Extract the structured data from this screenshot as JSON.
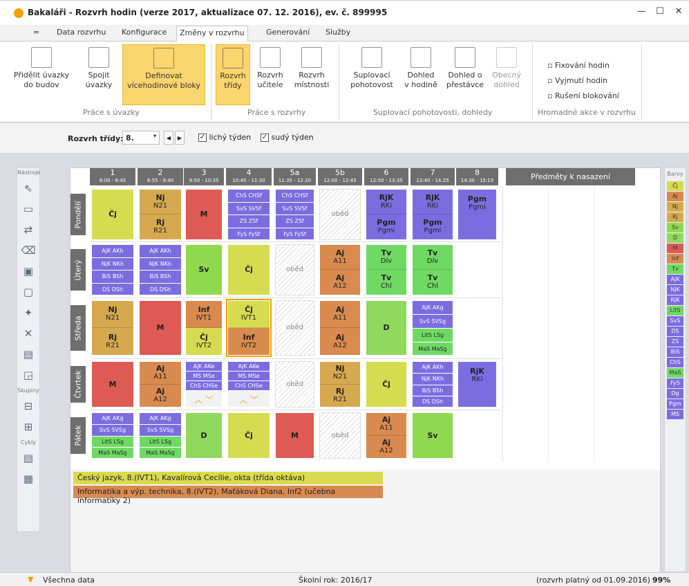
{
  "window": {
    "title": "Bakaláři - Rozvrh hodin (verze 2017, aktualizace 07. 12. 2016), ev. č. 899995",
    "minimize": "—",
    "maximize": "☐",
    "close": "✕"
  },
  "menu": {
    "tabs": [
      "=",
      "Data rozvrhu",
      "Konfigurace",
      "Změny v rozvrhu",
      "Generování",
      "Služby"
    ]
  },
  "ribbon": {
    "buttons": [
      {
        "l1": "Přidělit úvazky",
        "l2": "do budov"
      },
      {
        "l1": "Spojit",
        "l2": "úvazky"
      },
      {
        "l1": "Definovat",
        "l2": "vícehodinové bloky"
      },
      {
        "l1": "Rozvrh",
        "l2": "třídy"
      },
      {
        "l1": "Rozvrh",
        "l2": "učitele"
      },
      {
        "l1": "Rozvrh",
        "l2": "místnosti"
      },
      {
        "l1": "Suplovací",
        "l2": "pohotovost"
      },
      {
        "l1": "Dohled",
        "l2": "v hodině"
      },
      {
        "l1": "Dohled o",
        "l2": "přestávce"
      },
      {
        "l1": "Obecný",
        "l2": "dohled"
      }
    ],
    "small": [
      "Fixování hodin",
      "Vyjmutí hodin",
      "Rušení blokování"
    ],
    "groups": [
      "Práce s úvazky",
      "Práce s rozvrhy",
      "Suplovací pohotovosti, dohledy",
      "Hromadné akce v rozvrhu"
    ]
  },
  "filter": {
    "label": "Rozvrh třídy:",
    "value": "8.",
    "odd": "lichý týden",
    "even": "sudý týden",
    "check": "✓"
  },
  "leftbar": {
    "h1": "Nástroje",
    "h2": "Skupiny",
    "h3": "Cykly"
  },
  "header": {
    "periods": [
      {
        "n": "1",
        "t": "8:00 - 8:45"
      },
      {
        "n": "2",
        "t": "8:55 - 9:40"
      },
      {
        "n": "3",
        "t": "9:50 - 10:35"
      },
      {
        "n": "4",
        "t": "10:45 - 11:30"
      },
      {
        "n": "5a",
        "t": "11:35 - 12:20"
      },
      {
        "n": "5b",
        "t": "12:00 - 12:45"
      },
      {
        "n": "6",
        "t": "12:50 - 13:35"
      },
      {
        "n": "7",
        "t": "13:40 - 14:25"
      },
      {
        "n": "8",
        "t": "14:30 - 15:15"
      }
    ],
    "subjects_panel": "Předměty k nasazení"
  },
  "days": [
    "Pondělí",
    "Úterý",
    "Středa",
    "Čtvrtek",
    "Pátek"
  ],
  "obed": "oběd",
  "info": [
    "Český jazyk, 8.(IVT1), Kavalírová Cecílie, okta (třída oktáva)",
    "Informatika a výp. technika, 8.(IVT2), Maťáková Diana, Inf2 (učebna informatiky 2)"
  ],
  "legend": {
    "title": "Barvy",
    "items": [
      "Čj",
      "Aj",
      "Nj",
      "Rj",
      "Sv",
      "D",
      "M",
      "Inf",
      "Tv",
      "AjK",
      "NjK",
      "RjK",
      "LitS",
      "SvS",
      "DS",
      "ZS",
      "BiS",
      "ChS",
      "MaS",
      "FyS",
      "Dg",
      "Pgm",
      "MS"
    ]
  },
  "status": {
    "left": "Všechna data",
    "mid": "Školní rok: 2016/17",
    "right": "(rozvrh platný od 01.09.2016)",
    "zoom": "99%"
  }
}
